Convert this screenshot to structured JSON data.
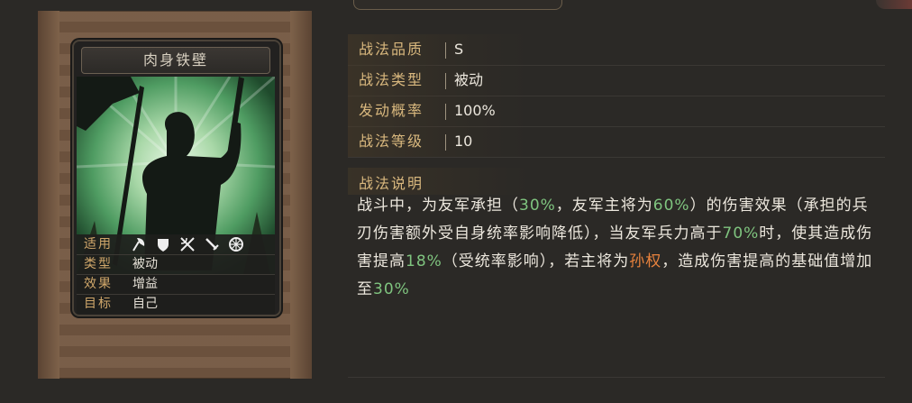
{
  "card": {
    "title": "肉身铁壁",
    "info": [
      {
        "label": "适用",
        "icons": [
          "axe-icon",
          "shield-icon",
          "crossed-bows-icon",
          "sword-icon",
          "wheel-icon"
        ]
      },
      {
        "label": "类型",
        "value": "被动"
      },
      {
        "label": "效果",
        "value": "增益"
      },
      {
        "label": "目标",
        "value": "自己"
      }
    ]
  },
  "attributes": [
    {
      "label": "战法品质",
      "value": "S"
    },
    {
      "label": "战法类型",
      "value": "被动"
    },
    {
      "label": "发动概率",
      "value": "100%"
    },
    {
      "label": "战法等级",
      "value": "10"
    }
  ],
  "description": {
    "heading": "战法说明",
    "segments": [
      {
        "text": "战斗中，为友军承担（",
        "color": "normal"
      },
      {
        "text": "30%",
        "color": "green"
      },
      {
        "text": "，友军主将为",
        "color": "normal"
      },
      {
        "text": "60%",
        "color": "green"
      },
      {
        "text": "）的伤害效果（承担的兵刃伤害额外受自身统率影响降低），当友军兵力高于",
        "color": "normal"
      },
      {
        "text": "70%",
        "color": "green"
      },
      {
        "text": "时，使其造成伤害提高",
        "color": "normal"
      },
      {
        "text": "18%",
        "color": "green"
      },
      {
        "text": "（受统率影响），若主将为",
        "color": "normal"
      },
      {
        "text": "孙权",
        "color": "orange"
      },
      {
        "text": "，造成伤害提高的基础值增加至",
        "color": "normal"
      },
      {
        "text": "30%",
        "color": "green"
      }
    ]
  },
  "colors": {
    "label": "#d9b87e",
    "green": "#7fc47f",
    "orange": "#e8823d"
  }
}
